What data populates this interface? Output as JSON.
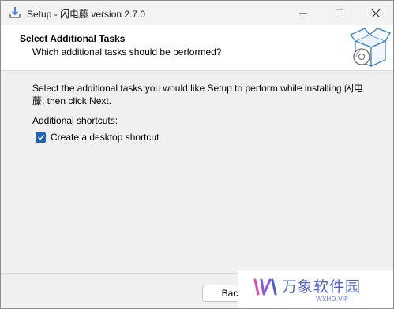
{
  "window": {
    "title": "Setup - 闪电藤 version 2.7.0"
  },
  "header": {
    "title": "Select Additional Tasks",
    "subtitle": "Which additional tasks should be performed?"
  },
  "content": {
    "description": "Select the additional tasks you would like Setup to perform while installing 闪电藤, then click Next.",
    "group_label": "Additional shortcuts:",
    "tasks": [
      {
        "label": "Create a desktop shortcut",
        "checked": true
      }
    ]
  },
  "buttons": {
    "back": "Back"
  },
  "watermark": {
    "text": "万象软件园",
    "url": "WXHD.VIP"
  },
  "colors": {
    "accent": "#1f63b8",
    "watermark": "#4c5fd6"
  }
}
